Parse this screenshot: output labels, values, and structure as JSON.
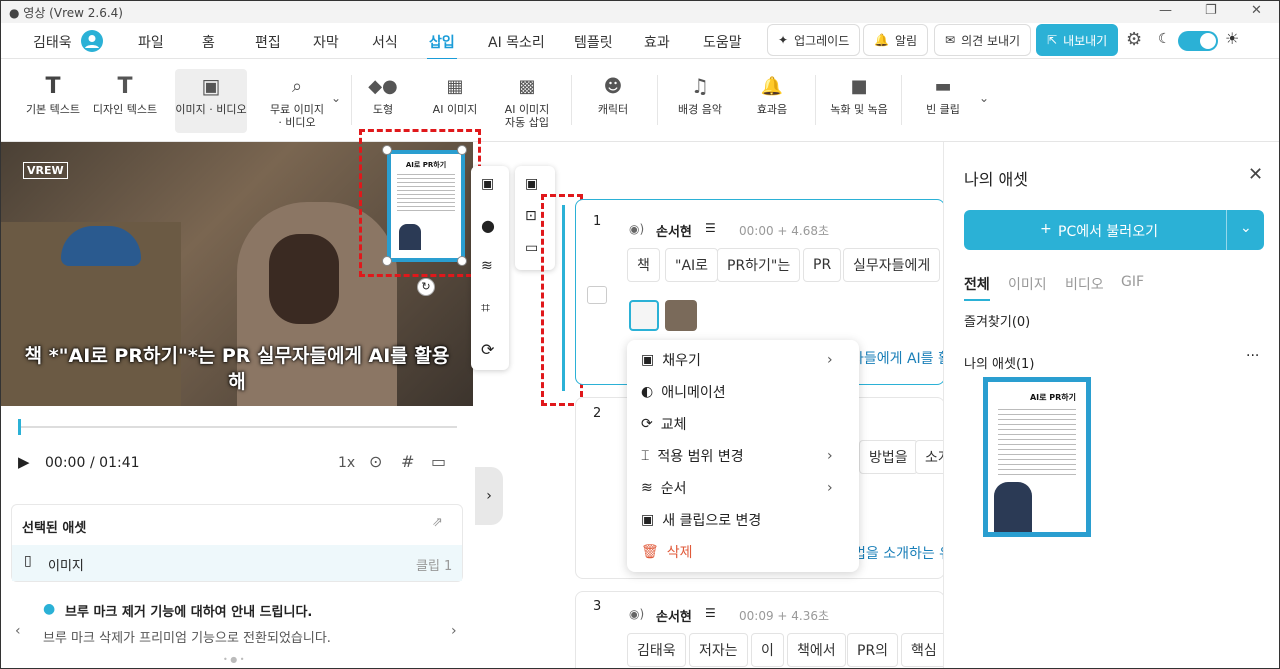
{
  "window": {
    "title": "● 영상 (Vrew 2.6.4)"
  },
  "menubar": {
    "user": "김태욱",
    "items": [
      "파일",
      "홈",
      "편집",
      "자막",
      "서식",
      "삽입",
      "AI 목소리",
      "템플릿",
      "효과",
      "도움말"
    ],
    "active": "삽입",
    "upgrade": "업그레이드",
    "notify": "알림",
    "feedback": "의견 보내기",
    "export": "내보내기"
  },
  "toolbar": {
    "items": [
      [
        "기본 텍스트",
        ""
      ],
      [
        "디자인 텍스트",
        ""
      ],
      [
        "이미지 · 비디오",
        ""
      ],
      [
        "무료 이미지",
        "· 비디오"
      ],
      [
        "도형",
        ""
      ],
      [
        "AI 이미지",
        ""
      ],
      [
        "AI 이미지",
        "자동 삽입"
      ],
      [
        "캐릭터",
        ""
      ],
      [
        "배경 음악",
        ""
      ],
      [
        "효과음",
        ""
      ],
      [
        "녹화 및 녹음",
        ""
      ],
      [
        "빈 클립",
        ""
      ]
    ]
  },
  "video": {
    "subtitle_line1": "책 *\"AI로 PR하기\"*는 PR 실무자들에게 AI를 활용",
    "subtitle_line2": "해",
    "thumb_title": "AI로 PR하기",
    "watermark": "VREW"
  },
  "player": {
    "time": "00:00",
    "duration": "/ 01:41",
    "speed": "1x"
  },
  "selected_asset": {
    "title": "선택된 애셋",
    "item": "이미지",
    "clip": "클립 1"
  },
  "notice": {
    "title": "브루 마크 제거 기능에 대하여 안내 드립니다.",
    "body": "브루 마크 삭제가 프리미엄 기능으로 전환되었습니다."
  },
  "clips": [
    {
      "num": "1",
      "speaker": "손서현",
      "time": "00:00 + 4.68초",
      "words": [
        "책",
        "\"AI로",
        "PR하기\"는",
        "PR",
        "실무자들에게"
      ],
      "text": "자들에게 AI를 활"
    },
    {
      "num": "2",
      "words": [
        "방법을",
        "소개"
      ],
      "text": "법을 소개하는 유"
    },
    {
      "num": "3",
      "speaker": "손서현",
      "time": "00:09 + 4.36초",
      "words": [
        "김태욱",
        "저자는",
        "이",
        "책에서",
        "PR의",
        "핵심"
      ]
    }
  ],
  "context_menu": {
    "items": [
      "채우기",
      "애니메이션",
      "교체",
      "적용 범위 변경",
      "순서",
      "새 클립으로 변경",
      "삭제"
    ]
  },
  "assets": {
    "title": "나의 애셋",
    "import": "PC에서 불러오기",
    "tabs": [
      "전체",
      "이미지",
      "비디오",
      "GIF"
    ],
    "favorites": "즐겨찾기(0)",
    "mine": "나의 애셋(1)",
    "thumb_title": "AI로 PR하기"
  },
  "colors": {
    "accent": "#2bb1d6",
    "danger": "#e0181b"
  }
}
